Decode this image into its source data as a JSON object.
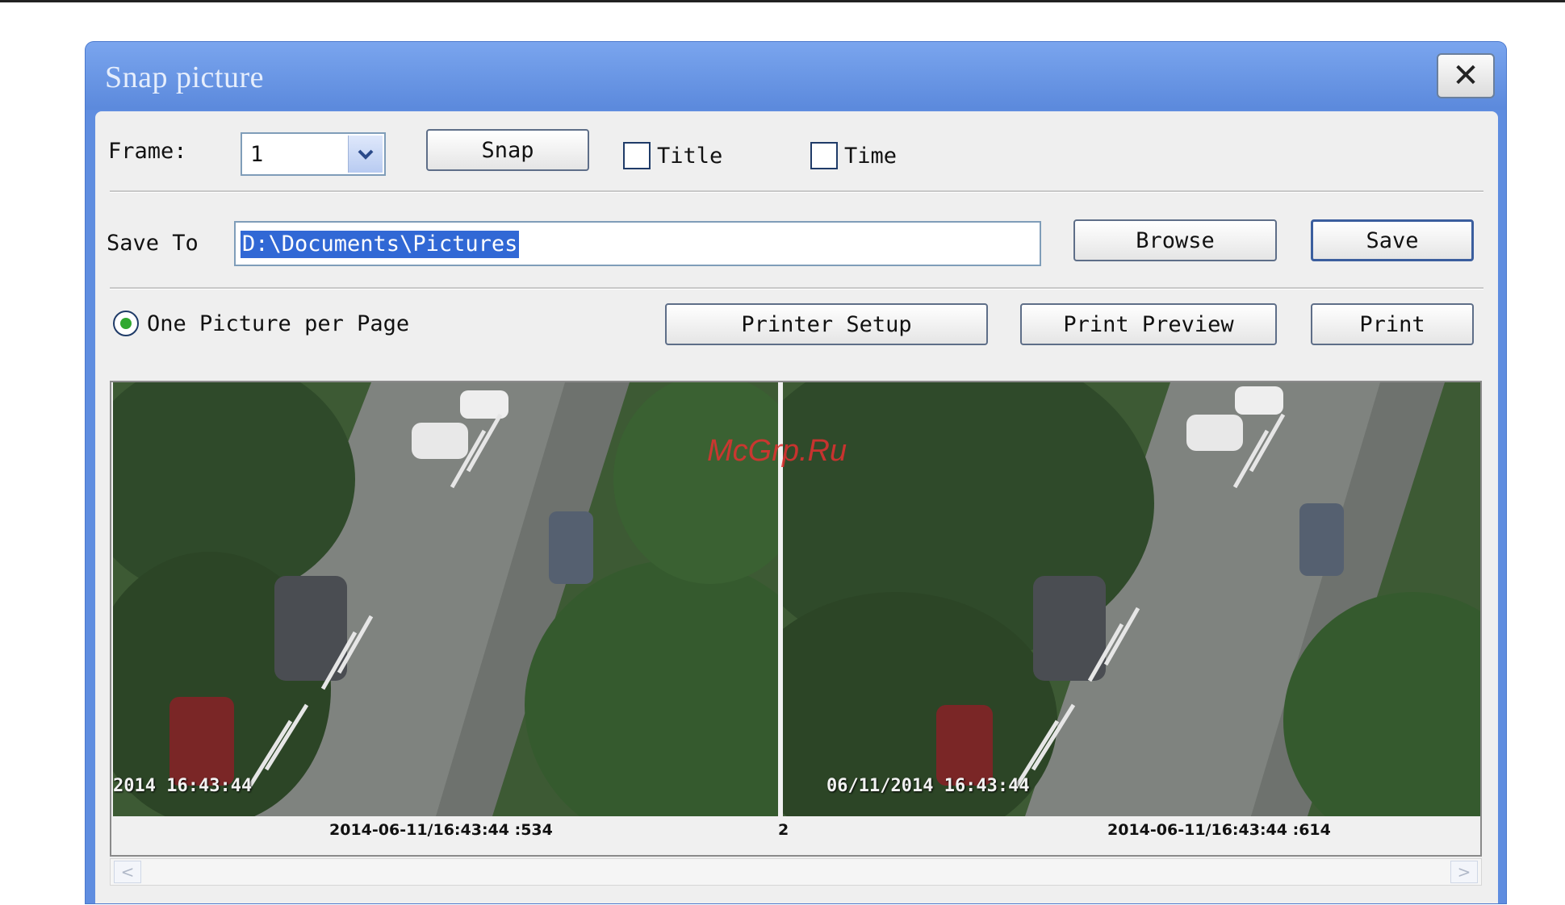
{
  "window": {
    "title": "Snap picture",
    "close_glyph": "✕"
  },
  "row1": {
    "frame_label": "Frame:",
    "frame_value": "1",
    "snap_label": "Snap",
    "title_check_label": "Title",
    "title_checked": false,
    "time_check_label": "Time",
    "time_checked": false
  },
  "row2": {
    "save_to_label": "Save To",
    "path_value": "D:\\Documents\\Pictures",
    "browse_label": "Browse",
    "save_label": "Save"
  },
  "row3": {
    "one_per_page_label": "One Picture per Page",
    "one_per_page_selected": true,
    "printer_setup_label": "Printer Setup",
    "print_preview_label": "Print Preview",
    "print_label": "Print"
  },
  "preview": {
    "items": [
      {
        "index": "",
        "stamp": "2014 16:43:44",
        "caption": "2014-06-11/16:43:44 :534"
      },
      {
        "index": "2",
        "stamp": "06/11/2014 16:43:44",
        "caption": "2014-06-11/16:43:44 :614"
      }
    ],
    "watermark": "McGrp.Ru"
  },
  "colors": {
    "title_bar": "#5f8de0",
    "selection": "#3168d5",
    "radio_dot": "#2fa82f"
  }
}
